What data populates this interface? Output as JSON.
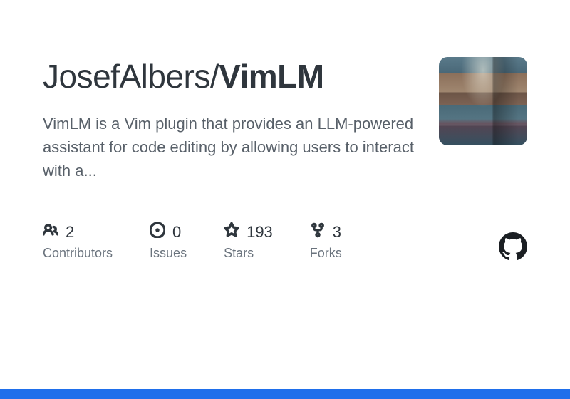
{
  "repo": {
    "owner": "JosefAlbers",
    "separator": "/",
    "name": "VimLM",
    "description": "VimLM is a Vim plugin that provides an LLM-powered assistant for code editing by allowing users to interact with a..."
  },
  "stats": {
    "contributors": {
      "count": "2",
      "label": "Contributors"
    },
    "issues": {
      "count": "0",
      "label": "Issues"
    },
    "stars": {
      "count": "193",
      "label": "Stars"
    },
    "forks": {
      "count": "3",
      "label": "Forks"
    }
  },
  "colors": {
    "accent_bar": "#1f6feb"
  }
}
